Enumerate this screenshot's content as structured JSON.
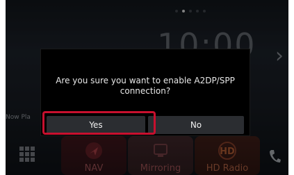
{
  "background": {
    "clock": "10:00",
    "now_playing": "Now Pla",
    "page_dots": [
      false,
      true,
      false,
      false,
      false
    ],
    "tiles": [
      {
        "label": "NAV",
        "icon": "navigation-icon"
      },
      {
        "label": "Mirroring",
        "icon": "mirroring-icon"
      },
      {
        "label": "HD Radio",
        "icon": "hd-radio-icon"
      }
    ],
    "menu_icon": "grid-menu-icon",
    "phone_icon": "phone-icon",
    "next_icon": "chevron-right-icon"
  },
  "dialog": {
    "message": "Are you sure you want to enable A2DP/SPP connection?",
    "yes_label": "Yes",
    "no_label": "No"
  },
  "colors": {
    "highlight": "#c8102e",
    "dialog_bg": "#000000",
    "button_bg": "#2b2d31"
  }
}
